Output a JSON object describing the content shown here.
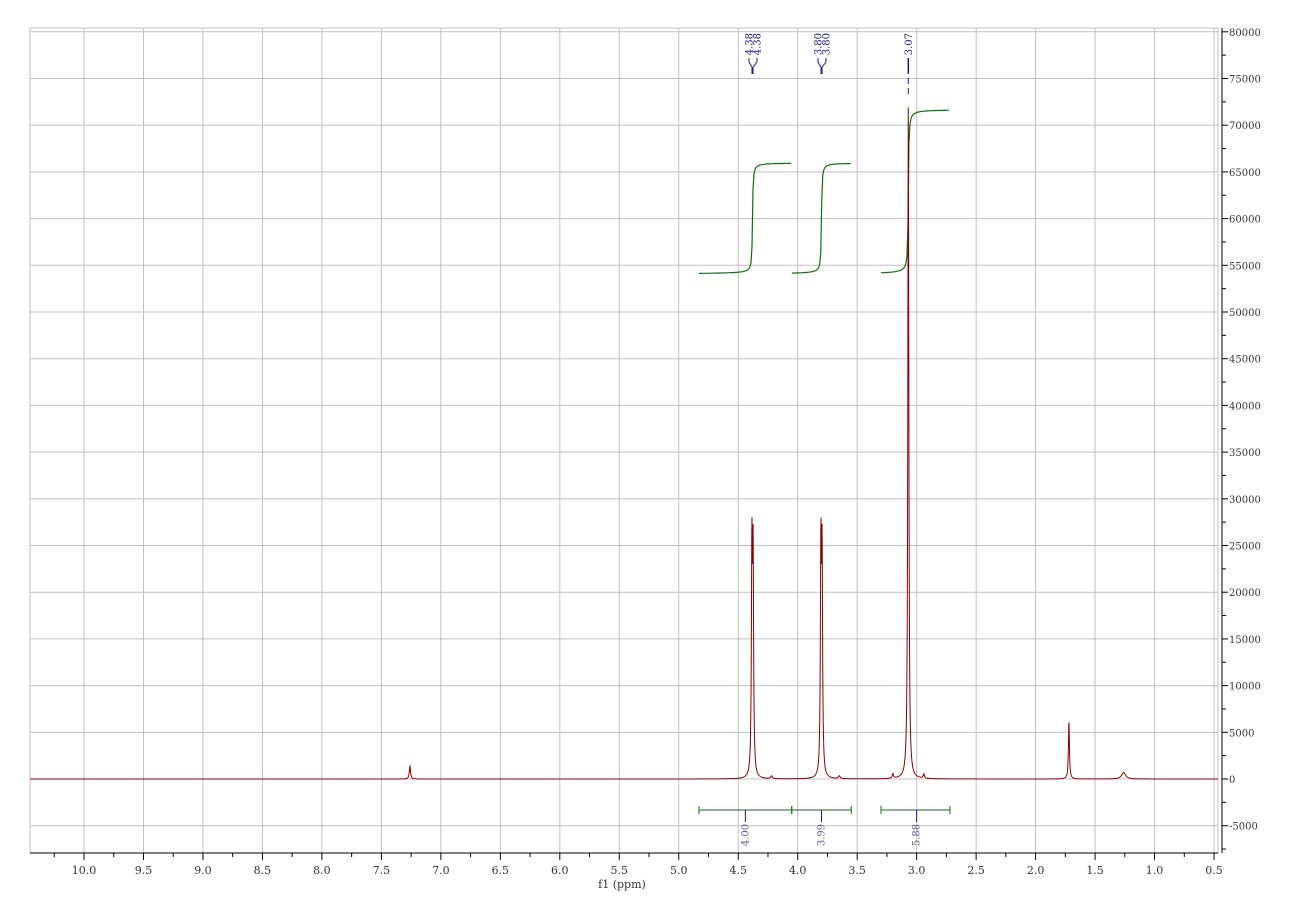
{
  "chart_data": {
    "type": "line",
    "title": "",
    "xlabel": "f1 (ppm)",
    "ylabel": "",
    "xlim": [
      10.45,
      0.47
    ],
    "ylim": [
      -7800,
      80400
    ],
    "grid": true,
    "x_ticks": [
      "10.0",
      "9.5",
      "9.0",
      "8.5",
      "8.0",
      "7.5",
      "7.0",
      "6.5",
      "6.0",
      "5.5",
      "5.0",
      "4.5",
      "4.0",
      "3.5",
      "3.0",
      "2.5",
      "2.0",
      "1.5",
      "1.0",
      "0.5"
    ],
    "y_ticks": [
      "80000",
      "75000",
      "70000",
      "65000",
      "60000",
      "55000",
      "50000",
      "45000",
      "40000",
      "35000",
      "30000",
      "25000",
      "20000",
      "15000",
      "10000",
      "5000",
      "0",
      "-5000"
    ],
    "peaks": [
      {
        "ppm": 7.26,
        "height": 1400,
        "width": 0.006
      },
      {
        "ppm": 4.385,
        "height": 23500,
        "width": 0.005
      },
      {
        "ppm": 4.375,
        "height": 22500,
        "width": 0.005
      },
      {
        "ppm": 4.22,
        "height": 300,
        "width": 0.008
      },
      {
        "ppm": 3.805,
        "height": 23500,
        "width": 0.005
      },
      {
        "ppm": 3.795,
        "height": 22500,
        "width": 0.005
      },
      {
        "ppm": 3.65,
        "height": 300,
        "width": 0.008
      },
      {
        "ppm": 3.2,
        "height": 500,
        "width": 0.006
      },
      {
        "ppm": 3.07,
        "height": 73000,
        "width": 0.005
      },
      {
        "ppm": 2.94,
        "height": 450,
        "width": 0.006
      },
      {
        "ppm": 1.72,
        "height": 6200,
        "width": 0.005
      },
      {
        "ppm": 1.26,
        "height": 700,
        "width": 0.02
      }
    ],
    "peak_labels": [
      {
        "group": [
          "4.38",
          "4.38"
        ],
        "ppm": 4.38
      },
      {
        "group": [
          "3.80",
          "3.80"
        ],
        "ppm": 3.8
      },
      {
        "group": [
          "3.07"
        ],
        "ppm": 3.07
      }
    ],
    "integrals": [
      {
        "from": 4.83,
        "to": 4.05,
        "center": 4.44,
        "value": "4.00",
        "curve_start": 54100,
        "curve_end": 66000
      },
      {
        "from": 4.05,
        "to": 3.55,
        "center": 3.8,
        "value": "3.99",
        "curve_start": 54100,
        "curve_end": 66000
      },
      {
        "from": 3.3,
        "to": 2.72,
        "center": 3.0,
        "value": "5.88",
        "curve_start": 54100,
        "curve_end": 71700
      }
    ],
    "colors": {
      "spectrum": "#8b0000",
      "integral": "#107010",
      "label": "#1a1a8c",
      "grid": "#c0c0c0"
    }
  }
}
